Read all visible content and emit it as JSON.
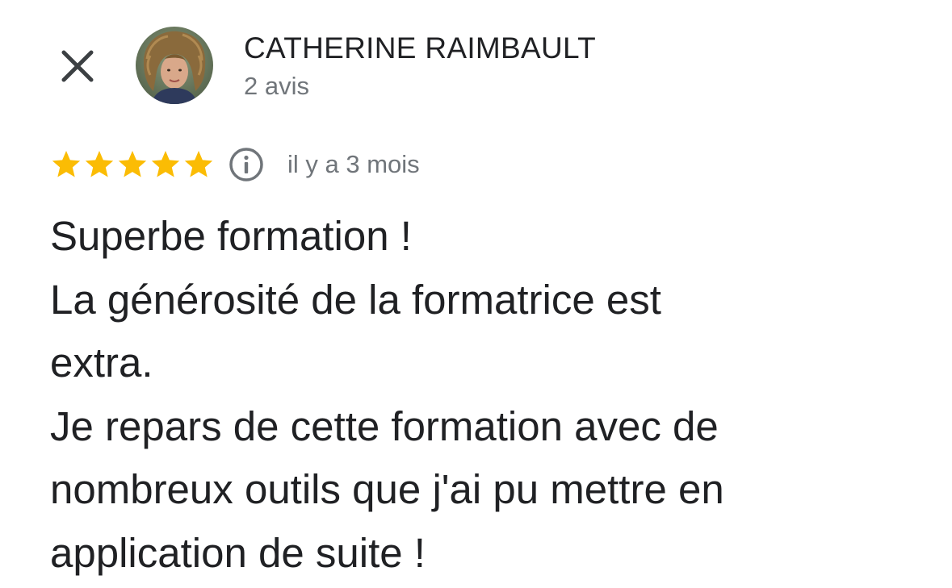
{
  "header": {
    "close_icon": "close-icon",
    "avatar_icon": "avatar",
    "author_name": "CATHERINE RAIMBAULT",
    "author_review_count": "2 avis"
  },
  "rating": {
    "stars": 5,
    "max_stars": 5,
    "star_color": "#fbbc04",
    "info_icon": "info-icon",
    "date": "il y a 3 mois"
  },
  "review": {
    "lines": [
      "Superbe formation !",
      "La générosité de la formatrice est",
      "extra.",
      "Je repars de cette formation avec de",
      "nombreux outils que j'ai pu mettre en",
      "application de suite !"
    ]
  }
}
